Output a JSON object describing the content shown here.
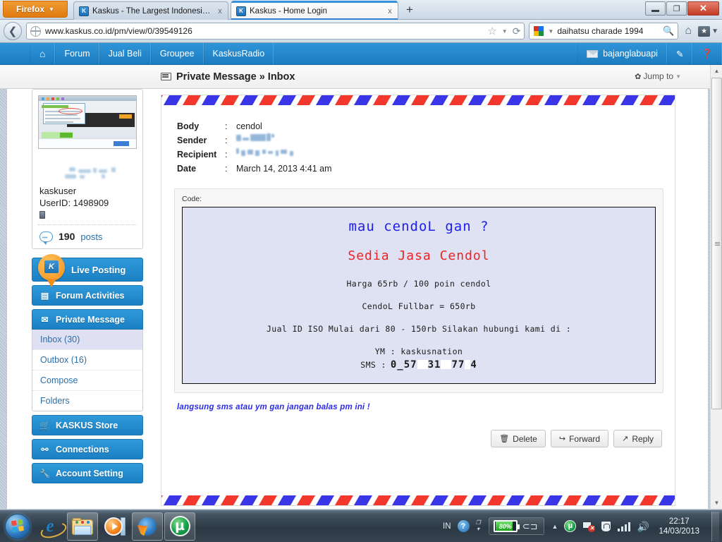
{
  "browser": {
    "firefox_button": "Firefox",
    "tabs": [
      {
        "title": "Kaskus - The Largest Indonesian Com...",
        "favicon": "kaskus-favicon",
        "active": false,
        "close": "x"
      },
      {
        "title": "Kaskus - Home Login",
        "favicon": "kaskus-favicon",
        "active": true,
        "close": "x"
      }
    ],
    "new_tab": "+",
    "url": "www.kaskus.co.id/pm/view/0/39549126",
    "search_value": "daihatsu charade 1994",
    "window_controls": {
      "minimize": "–",
      "restore": "❐",
      "close": "✕"
    }
  },
  "site_nav": {
    "home_icon": "home-icon",
    "items": [
      "Forum",
      "Jual Beli",
      "Groupee",
      "KaskusRadio"
    ],
    "username": "bajanglabuapi",
    "compose_icon": "pencil-icon",
    "help_icon": "help-icon"
  },
  "page_header": {
    "title_main": "Private Message",
    "title_sep": "»",
    "title_sub": "Inbox",
    "jump_to": "Jump to"
  },
  "sidebar": {
    "profile": {
      "thumbnail": "user-screenshot-thumbnail",
      "username_blurred": true,
      "usergroup": "kaskuser",
      "userid_label": "UserID: 1498909",
      "post_count": "190",
      "post_word": "posts"
    },
    "live_posting": {
      "label": "Live Posting",
      "icon": "kaskus-pin-icon"
    },
    "menu": [
      {
        "label": "Forum Activities",
        "icon": "newspaper-icon"
      },
      {
        "label": "Private Message",
        "icon": "envelope-icon"
      }
    ],
    "submenu": [
      {
        "label": "Inbox (30)",
        "active": true
      },
      {
        "label": "Outbox (16)",
        "active": false
      },
      {
        "label": "Compose",
        "active": false
      },
      {
        "label": "Folders",
        "active": false
      }
    ],
    "menu_bottom": [
      {
        "label": "KASKUS Store",
        "icon": "cart-icon"
      },
      {
        "label": "Connections",
        "icon": "connections-icon"
      },
      {
        "label": "Account Setting",
        "icon": "wrench-icon"
      }
    ]
  },
  "message": {
    "fields": [
      {
        "label": "Body",
        "colon": ":",
        "value": "cendol",
        "redacted": false,
        "link": false
      },
      {
        "label": "Sender",
        "colon": ":",
        "value": "",
        "redacted": true,
        "link": true
      },
      {
        "label": "Recipient",
        "colon": ":",
        "value": "",
        "redacted": true,
        "link": true
      },
      {
        "label": "Date",
        "colon": ":",
        "value": "March 14, 2013 4:41 am",
        "redacted": false,
        "link": false
      }
    ],
    "code_label": "Code:",
    "code": {
      "heading": "mau cendoL gan ?",
      "subheading": "Sedia Jasa Cendol",
      "lines": [
        "Harga 65rb / 100 poin cendol",
        "CendoL Fullbar = 650rb",
        "Jual ID ISO Mulai dari 80 - 150rb Silakan hubungi kami di  :",
        "YM :  kaskusnation"
      ],
      "sms_label": "SMS :",
      "sms_number_part1": "0_57",
      "sms_number_part2": "31",
      "sms_number_part3": "77",
      "sms_number_part4": "4"
    },
    "note": "langsung sms atau ym gan jangan balas pm ini  !",
    "buttons": [
      {
        "label": "Delete",
        "icon": "trash-icon"
      },
      {
        "label": "Forward",
        "icon": "forward-icon"
      },
      {
        "label": "Reply",
        "icon": "reply-arrow-icon"
      }
    ]
  },
  "taskbar": {
    "start": "windows-start-orb",
    "apps": [
      {
        "name": "internet-explorer"
      },
      {
        "name": "windows-explorer"
      },
      {
        "name": "windows-media-player"
      },
      {
        "name": "firefox"
      },
      {
        "name": "utorrent"
      }
    ],
    "tray": {
      "language": "IN",
      "help_icon": "help-icon",
      "battery_percent": "80%",
      "plug_icon": "power-plug-icon",
      "expand_icon": "show-hidden-icons",
      "utorrent_icon": "utorrent-tray-icon",
      "network_icon": "network-error-icon",
      "defender_icon": "security-icon",
      "signal_icon": "signal-bars-icon",
      "volume_icon": "volume-icon",
      "time": "22:17",
      "date": "14/03/2013"
    }
  },
  "colors": {
    "kaskus_blue": "#1c7cc0",
    "accent_orange": "#f3901c",
    "code_bg": "#dfe2f2",
    "heading_blue": "#1d1df0",
    "sub_red": "#ee2222",
    "note_blue": "#2b2bea"
  }
}
